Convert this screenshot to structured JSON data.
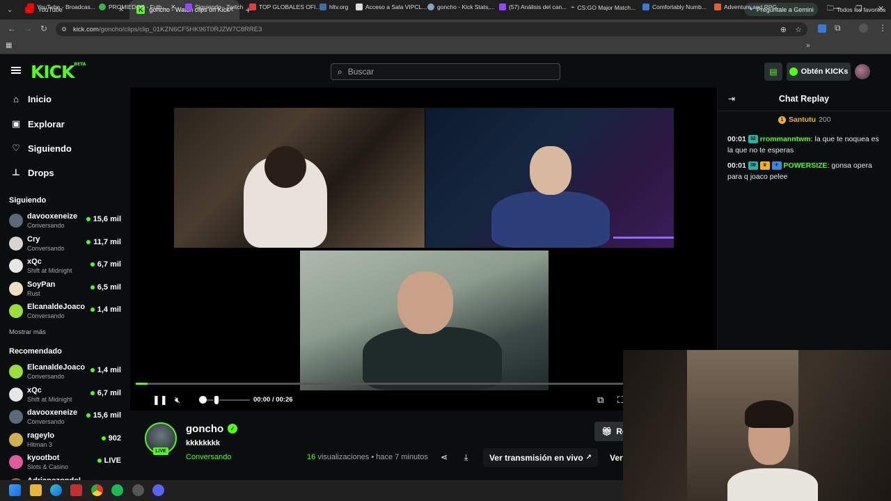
{
  "browser": {
    "tabs": [
      {
        "label": "YouTube",
        "icon": "youtube-icon"
      },
      {
        "label": "goncho - Watch clips on Kick",
        "icon": "kick-icon"
      }
    ],
    "gemini_label": "Pregúntale a Gemini",
    "url_host": "kick.com",
    "url_path": "/goncho/clips/clip_01KZN6CF5HK96T0RJZW7C8RRE3",
    "bookmarks": [
      "YouTube - Broadcas...",
      "PROMIEDOS - Futb...",
      "Siguiendo - Twitch",
      "TOP GLOBALES OFI...",
      "hltv.org",
      "Acceso a Sala VIPCL...",
      "goncho - Kick Stats,...",
      "(57) Análisis del can...",
      "CS:GO Major Match...",
      "Comfortably Numb...",
      "Adventure and RPG..."
    ],
    "all_bookmarks": "Todos los favoritos"
  },
  "header": {
    "logo": "KICK",
    "logo_sup": "BETA",
    "search_placeholder": "Buscar",
    "kicks_label": "Obtén KICKs"
  },
  "sidebar": {
    "nav": [
      {
        "label": "Inicio",
        "icon": "home-icon"
      },
      {
        "label": "Explorar",
        "icon": "explore-icon"
      },
      {
        "label": "Siguiendo",
        "icon": "heart-icon"
      },
      {
        "label": "Drops",
        "icon": "drops-icon"
      }
    ],
    "following_title": "Siguiendo",
    "following": [
      {
        "name": "davooxeneize",
        "category": "Conversando",
        "viewers": "15,6 mil",
        "color": "#5a6a7a"
      },
      {
        "name": "Cry",
        "category": "Conversando",
        "viewers": "11,7 mil",
        "color": "#d9d4cf"
      },
      {
        "name": "xQc",
        "category": "Shift at Midnight",
        "viewers": "6,7 mil",
        "color": "#e6e6e6"
      },
      {
        "name": "SoyPan",
        "category": "Rust",
        "viewers": "6,5 mil",
        "color": "#f0e0c0"
      },
      {
        "name": "ElcanaldeJoaco",
        "category": "Conversando",
        "viewers": "1,4 mil",
        "color": "#9adf3a"
      }
    ],
    "show_more": "Mostrar más",
    "recommended_title": "Recomendado",
    "recommended": [
      {
        "name": "ElcanaldeJoaco",
        "category": "Conversando",
        "viewers": "1,4 mil",
        "color": "#9adf3a"
      },
      {
        "name": "xQc",
        "category": "Shift at Midnight",
        "viewers": "6,7 mil",
        "color": "#e6e6e6"
      },
      {
        "name": "davooxeneize",
        "category": "Conversando",
        "viewers": "15,6 mil",
        "color": "#5a6a7a"
      },
      {
        "name": "rageylo",
        "category": "Hitman 3",
        "viewers": "902",
        "color": "#d0b050"
      },
      {
        "name": "kyootbot",
        "category": "Slots & Casino",
        "viewers": "LIVE",
        "color": "#e05aa0"
      },
      {
        "name": "Adrianozondol",
        "category": "",
        "viewers": "12,3 mil",
        "color": "#806050"
      }
    ]
  },
  "player": {
    "time_current": "00:00",
    "time_sep": "/",
    "time_total": "00:26",
    "progress": 0.024
  },
  "clip": {
    "channel": "goncho",
    "live_badge": "LIVE",
    "title": "kkkkkkkk",
    "category": "Conversando",
    "views_count": "16",
    "views_label": "visualizaciones",
    "age": "• hace 7 minutos",
    "watch_live": "Ver transmisión en vivo",
    "watch_more": "Ver",
    "gift_label": "Re"
  },
  "chat": {
    "title": "Chat Replay",
    "pinned_user": "Santutu",
    "pinned_count": "200",
    "messages": [
      {
        "time": "00:01",
        "badge": "32",
        "user": "rrommanntwm",
        "user_color": "#53fc18",
        "text": "la que te noquea es la que no te esperas"
      },
      {
        "time": "00:01",
        "badge": "39",
        "user": "POWERSIZE",
        "user_color": "#53fc18",
        "text": "gonsa opera para q joaco pelee"
      }
    ]
  }
}
